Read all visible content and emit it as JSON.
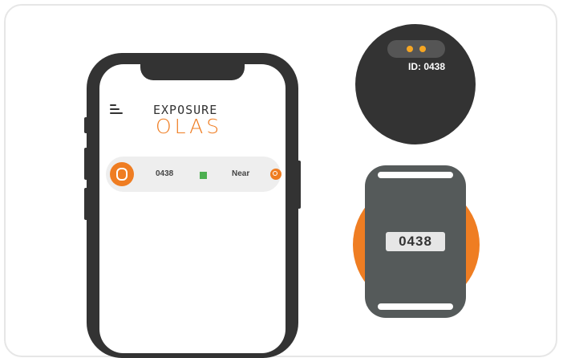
{
  "app": {
    "logo_line1": "EXPOSURE",
    "logo_line2": "OLAS"
  },
  "device_list": [
    {
      "id": "0438",
      "status_color": "#4caf50",
      "proximity": "Near"
    }
  ],
  "sensor": {
    "label": "ID: 0438"
  },
  "wearable": {
    "tag_text": "0438"
  },
  "colors": {
    "accent": "#ef7d22",
    "device_body": "#333333",
    "strap": "#555a5a",
    "status_green": "#4caf50",
    "led": "#f5a623"
  }
}
